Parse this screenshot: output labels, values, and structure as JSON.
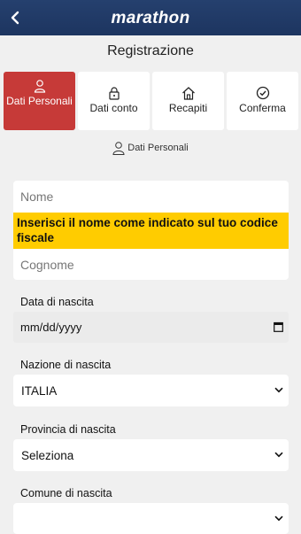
{
  "header": {
    "brand": "marathon"
  },
  "page": {
    "title": "Registrazione"
  },
  "steps": [
    {
      "label": "Dati Personali",
      "icon": "user-icon",
      "active": true
    },
    {
      "label": "Dati conto",
      "icon": "lock-icon",
      "active": false
    },
    {
      "label": "Recapiti",
      "icon": "home-icon",
      "active": false
    },
    {
      "label": "Conferma",
      "icon": "check-circle-icon",
      "active": false
    }
  ],
  "section": {
    "title": "Dati Personali"
  },
  "form": {
    "nome_placeholder": "Nome",
    "nome_hint": "Inserisci il nome come indicato sul tuo codice fiscale",
    "cognome_placeholder": "Cognome",
    "birthdate": {
      "label": "Data di nascita",
      "value": "mm/dd/yyyy"
    },
    "birth_country": {
      "label": "Nazione di nascita",
      "value": "ITALIA"
    },
    "birth_province": {
      "label": "Provincia di nascita",
      "value": "Seleziona"
    },
    "birth_city": {
      "label": "Comune di nascita",
      "value": ""
    }
  },
  "colors": {
    "header": "#1d3560",
    "active_step": "#c63a38",
    "hint": "#ffcc00"
  }
}
